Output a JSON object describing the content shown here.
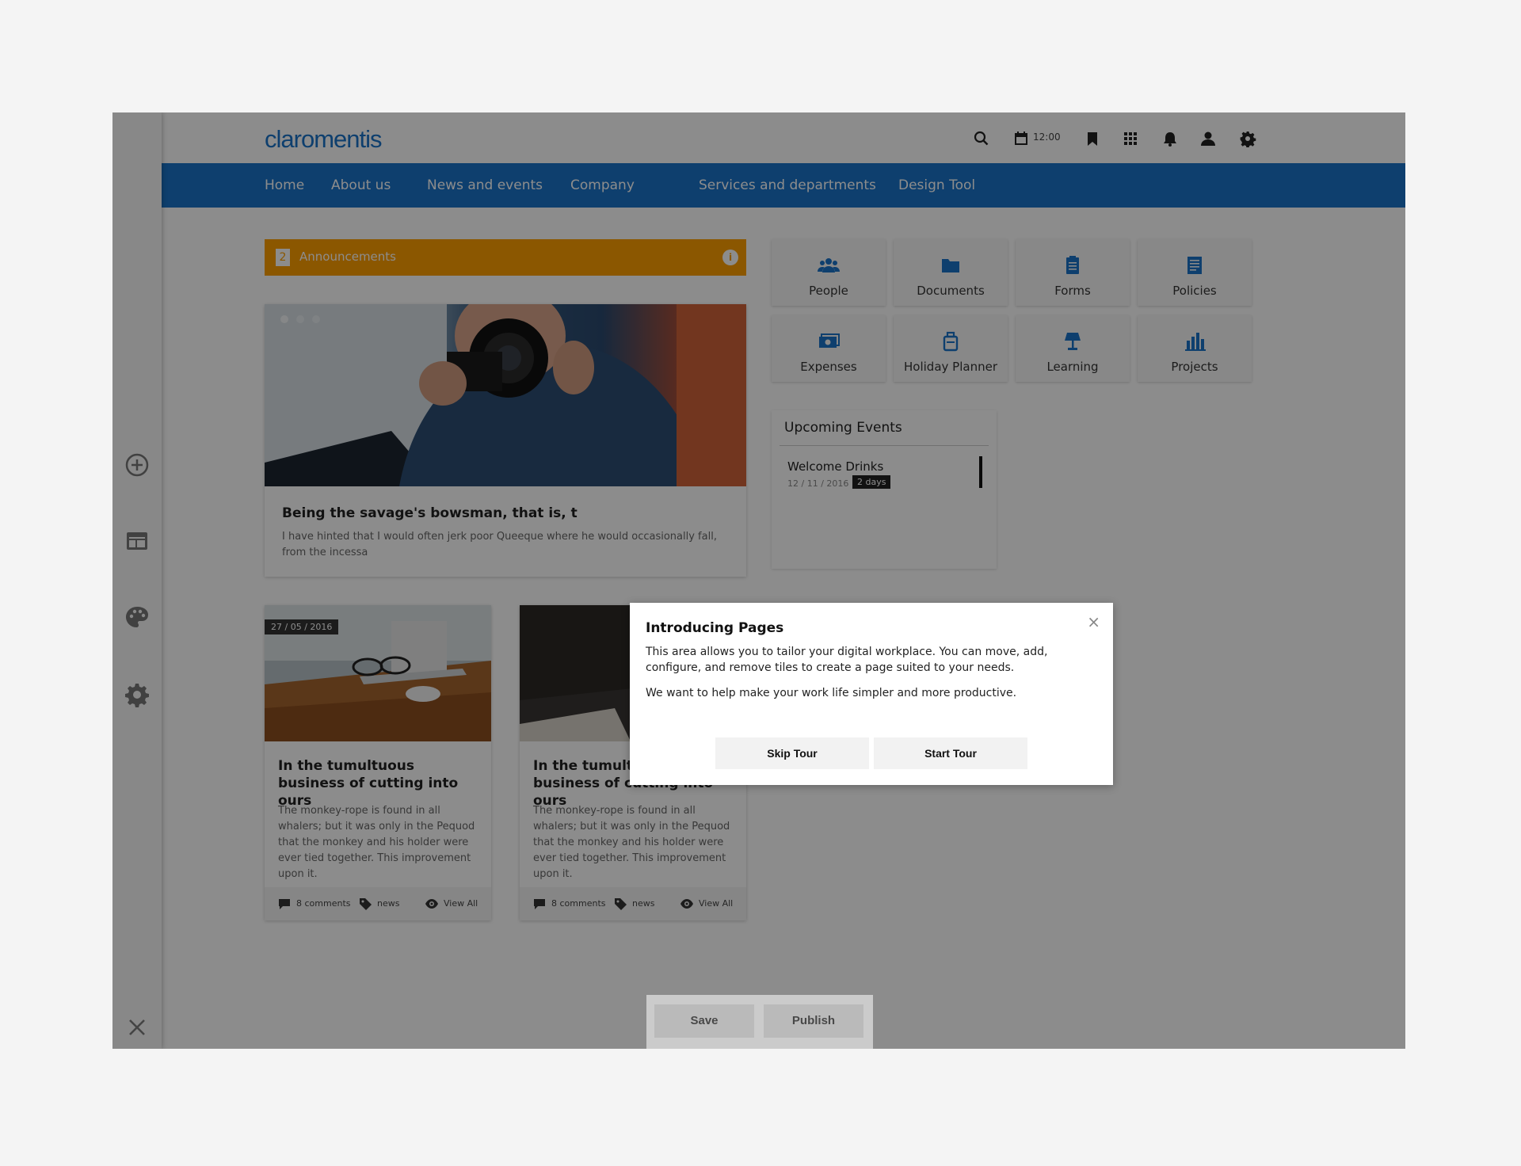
{
  "header": {
    "logo": "claromentis",
    "calendar_time": "12:00",
    "icons": [
      "search-icon",
      "calendar-icon",
      "bookmark-icon",
      "apps-grid-icon",
      "bell-icon",
      "user-icon",
      "gear-icon"
    ]
  },
  "nav": {
    "items": [
      "Home",
      "About us",
      "News and events",
      "Company",
      "Services and departments",
      "Design Tool"
    ]
  },
  "left_rail": {
    "icons": [
      "add-circle-icon",
      "layout-icon",
      "palette-icon",
      "settings-gear-icon",
      "close-icon"
    ]
  },
  "announcements": {
    "count": "2",
    "label": "Announcements",
    "info": "i"
  },
  "feature": {
    "title": "Being the savage's bowsman, that is, t",
    "text": "I have hinted that I would often jerk poor Queeque where he would occasionally fall, from the incessa"
  },
  "cards": [
    {
      "date": "27 / 05 / 2016",
      "title": "In the tumultuous business of cutting into ours",
      "text": "The monkey-rope is found in all whalers; but it was only in the Pequod that the monkey and his holder were ever tied together. This improvement upon it.",
      "comments": "8 comments",
      "tag": "news",
      "view": "View All"
    },
    {
      "date": "",
      "title": "In the tumultuous business of cutting into ours",
      "text": "The monkey-rope is found in all whalers; but it was only in the Pequod that the monkey and his holder were ever tied together. This improvement upon it.",
      "comments": "8 comments",
      "tag": "news",
      "view": "View All"
    }
  ],
  "tiles": [
    {
      "label": "People",
      "icon": "people-icon"
    },
    {
      "label": "Documents",
      "icon": "folder-icon"
    },
    {
      "label": "Forms",
      "icon": "clipboard-icon"
    },
    {
      "label": "Policies",
      "icon": "document-icon"
    },
    {
      "label": "Expenses",
      "icon": "money-icon"
    },
    {
      "label": "Holiday Planner",
      "icon": "luggage-icon"
    },
    {
      "label": "Learning",
      "icon": "lamp-icon"
    },
    {
      "label": "Projects",
      "icon": "bar-chart-icon"
    }
  ],
  "events": {
    "title": "Upcoming Events",
    "item_name": "Welcome Drinks",
    "item_date": "12 / 11 / 2016",
    "item_badge": "2 days"
  },
  "savebar": {
    "save": "Save",
    "publish": "Publish"
  },
  "modal": {
    "title": "Introducing Pages",
    "close": "×",
    "text1": "This area allows you to tailor your digital workplace. You can move, add, configure, and remove tiles to create a page suited to your needs.",
    "text2": "We want to help make your work life simpler and more productive.",
    "skip": "Skip Tour",
    "start": "Start Tour"
  },
  "colors": {
    "brand_blue": "#1a73c8",
    "announcement_orange": "#fd9e00",
    "overlay": "rgba(0,0,0,0.45)"
  }
}
